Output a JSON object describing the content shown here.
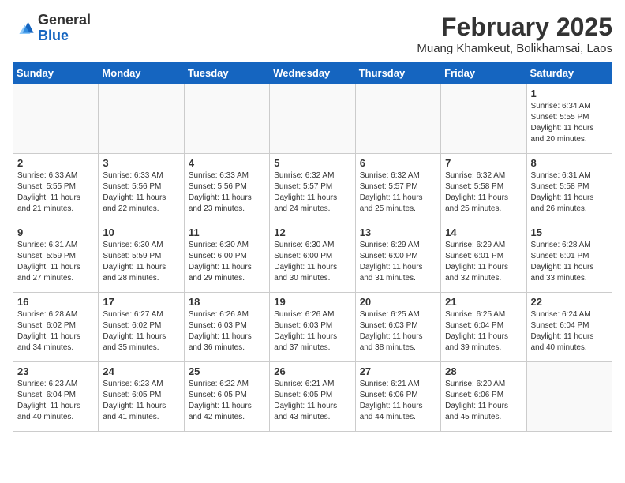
{
  "header": {
    "logo_general": "General",
    "logo_blue": "Blue",
    "month_title": "February 2025",
    "location": "Muang Khamkeut, Bolikhamsai, Laos"
  },
  "days_of_week": [
    "Sunday",
    "Monday",
    "Tuesday",
    "Wednesday",
    "Thursday",
    "Friday",
    "Saturday"
  ],
  "weeks": [
    [
      {
        "day": "",
        "info": ""
      },
      {
        "day": "",
        "info": ""
      },
      {
        "day": "",
        "info": ""
      },
      {
        "day": "",
        "info": ""
      },
      {
        "day": "",
        "info": ""
      },
      {
        "day": "",
        "info": ""
      },
      {
        "day": "1",
        "info": "Sunrise: 6:34 AM\nSunset: 5:55 PM\nDaylight: 11 hours and 20 minutes."
      }
    ],
    [
      {
        "day": "2",
        "info": "Sunrise: 6:33 AM\nSunset: 5:55 PM\nDaylight: 11 hours and 21 minutes."
      },
      {
        "day": "3",
        "info": "Sunrise: 6:33 AM\nSunset: 5:56 PM\nDaylight: 11 hours and 22 minutes."
      },
      {
        "day": "4",
        "info": "Sunrise: 6:33 AM\nSunset: 5:56 PM\nDaylight: 11 hours and 23 minutes."
      },
      {
        "day": "5",
        "info": "Sunrise: 6:32 AM\nSunset: 5:57 PM\nDaylight: 11 hours and 24 minutes."
      },
      {
        "day": "6",
        "info": "Sunrise: 6:32 AM\nSunset: 5:57 PM\nDaylight: 11 hours and 25 minutes."
      },
      {
        "day": "7",
        "info": "Sunrise: 6:32 AM\nSunset: 5:58 PM\nDaylight: 11 hours and 25 minutes."
      },
      {
        "day": "8",
        "info": "Sunrise: 6:31 AM\nSunset: 5:58 PM\nDaylight: 11 hours and 26 minutes."
      }
    ],
    [
      {
        "day": "9",
        "info": "Sunrise: 6:31 AM\nSunset: 5:59 PM\nDaylight: 11 hours and 27 minutes."
      },
      {
        "day": "10",
        "info": "Sunrise: 6:30 AM\nSunset: 5:59 PM\nDaylight: 11 hours and 28 minutes."
      },
      {
        "day": "11",
        "info": "Sunrise: 6:30 AM\nSunset: 6:00 PM\nDaylight: 11 hours and 29 minutes."
      },
      {
        "day": "12",
        "info": "Sunrise: 6:30 AM\nSunset: 6:00 PM\nDaylight: 11 hours and 30 minutes."
      },
      {
        "day": "13",
        "info": "Sunrise: 6:29 AM\nSunset: 6:00 PM\nDaylight: 11 hours and 31 minutes."
      },
      {
        "day": "14",
        "info": "Sunrise: 6:29 AM\nSunset: 6:01 PM\nDaylight: 11 hours and 32 minutes."
      },
      {
        "day": "15",
        "info": "Sunrise: 6:28 AM\nSunset: 6:01 PM\nDaylight: 11 hours and 33 minutes."
      }
    ],
    [
      {
        "day": "16",
        "info": "Sunrise: 6:28 AM\nSunset: 6:02 PM\nDaylight: 11 hours and 34 minutes."
      },
      {
        "day": "17",
        "info": "Sunrise: 6:27 AM\nSunset: 6:02 PM\nDaylight: 11 hours and 35 minutes."
      },
      {
        "day": "18",
        "info": "Sunrise: 6:26 AM\nSunset: 6:03 PM\nDaylight: 11 hours and 36 minutes."
      },
      {
        "day": "19",
        "info": "Sunrise: 6:26 AM\nSunset: 6:03 PM\nDaylight: 11 hours and 37 minutes."
      },
      {
        "day": "20",
        "info": "Sunrise: 6:25 AM\nSunset: 6:03 PM\nDaylight: 11 hours and 38 minutes."
      },
      {
        "day": "21",
        "info": "Sunrise: 6:25 AM\nSunset: 6:04 PM\nDaylight: 11 hours and 39 minutes."
      },
      {
        "day": "22",
        "info": "Sunrise: 6:24 AM\nSunset: 6:04 PM\nDaylight: 11 hours and 40 minutes."
      }
    ],
    [
      {
        "day": "23",
        "info": "Sunrise: 6:23 AM\nSunset: 6:04 PM\nDaylight: 11 hours and 40 minutes."
      },
      {
        "day": "24",
        "info": "Sunrise: 6:23 AM\nSunset: 6:05 PM\nDaylight: 11 hours and 41 minutes."
      },
      {
        "day": "25",
        "info": "Sunrise: 6:22 AM\nSunset: 6:05 PM\nDaylight: 11 hours and 42 minutes."
      },
      {
        "day": "26",
        "info": "Sunrise: 6:21 AM\nSunset: 6:05 PM\nDaylight: 11 hours and 43 minutes."
      },
      {
        "day": "27",
        "info": "Sunrise: 6:21 AM\nSunset: 6:06 PM\nDaylight: 11 hours and 44 minutes."
      },
      {
        "day": "28",
        "info": "Sunrise: 6:20 AM\nSunset: 6:06 PM\nDaylight: 11 hours and 45 minutes."
      },
      {
        "day": "",
        "info": ""
      }
    ]
  ]
}
